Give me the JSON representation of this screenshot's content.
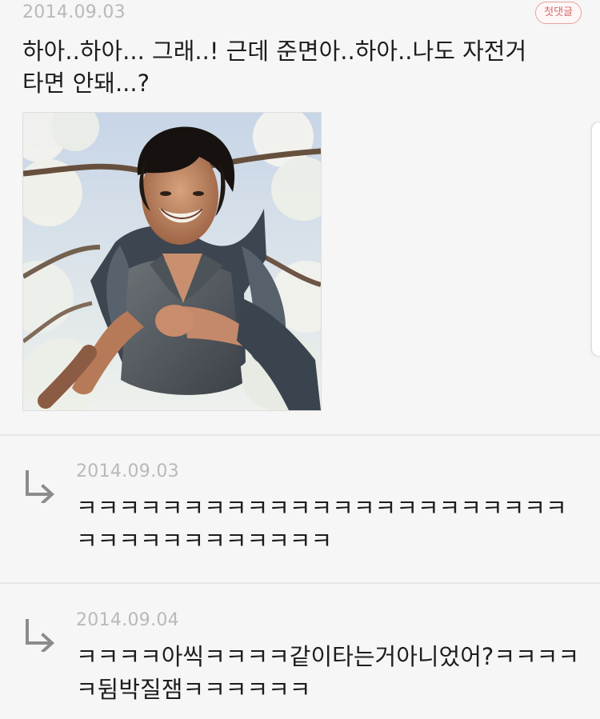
{
  "post": {
    "date": "2014.09.03",
    "badge": "첫댓글",
    "text": "하아..하아... 그래..! 근데 준면아..하아..나도 자전거 타면 안돼...?",
    "image": "running-man-photo"
  },
  "replies": [
    {
      "date": "2014.09.03",
      "text": "ㅋㅋㅋㅋㅋㅋㅋㅋㅋㅋㅋㅋㅋㅋㅋㅋㅋㅋㅋㅋㅋㅋㅋㅋㅋㅋㅋㅋㅋㅋㅋㅋㅋㅋㅋ"
    },
    {
      "date": "2014.09.04",
      "text": "ㅋㅋㅋㅋ아씩ㅋㅋㅋㅋ같이타는거아니었어?ㅋㅋㅋㅋㅋ뒴박질잼ㅋㅋㅋㅋㅋㅋ"
    }
  ],
  "icons": {
    "reply": "reply-arrow-icon"
  },
  "colors": {
    "background": "#f6f6f6",
    "date": "#b9b9b9",
    "badge_border": "#e9a0a0",
    "badge_text": "#d46a6a",
    "text": "#1d1d1d"
  }
}
